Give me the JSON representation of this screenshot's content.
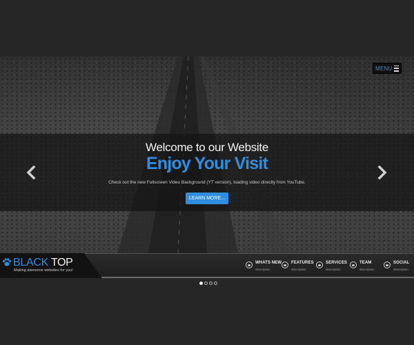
{
  "menu": {
    "label": "MENU",
    "icon": "hamburger-icon"
  },
  "hero": {
    "welcome": "Welcome to our Website",
    "tagline": "Enjoy Your Visit",
    "description": "Check out the new Fullscreen Video Background (YT version), loading video directly from YouTube.",
    "cta_label": "LEARN MORE...",
    "prev_icon": "chevron-left-icon",
    "next_icon": "chevron-right-icon"
  },
  "brand": {
    "name_part1": "BLACK",
    "name_part2": " TOP",
    "slogan": "Making awesome websites for you!",
    "icon": "paw-icon"
  },
  "nav": [
    {
      "label": "WHATS NEW",
      "sub": "description",
      "icon": "eye-icon"
    },
    {
      "label": "FEATURES",
      "sub": "description",
      "icon": "eye-icon"
    },
    {
      "label": "SERVICES",
      "sub": "description",
      "icon": "eye-icon"
    },
    {
      "label": "TEAM",
      "sub": "description",
      "icon": "eye-icon"
    },
    {
      "label": "SOCIAL",
      "sub": "description",
      "icon": "eye-icon"
    }
  ],
  "slider": {
    "total": 4,
    "active_index": 0
  },
  "colors": {
    "accent": "#2f8ee0",
    "background": "#262626",
    "bar": "#1f1f1f"
  }
}
